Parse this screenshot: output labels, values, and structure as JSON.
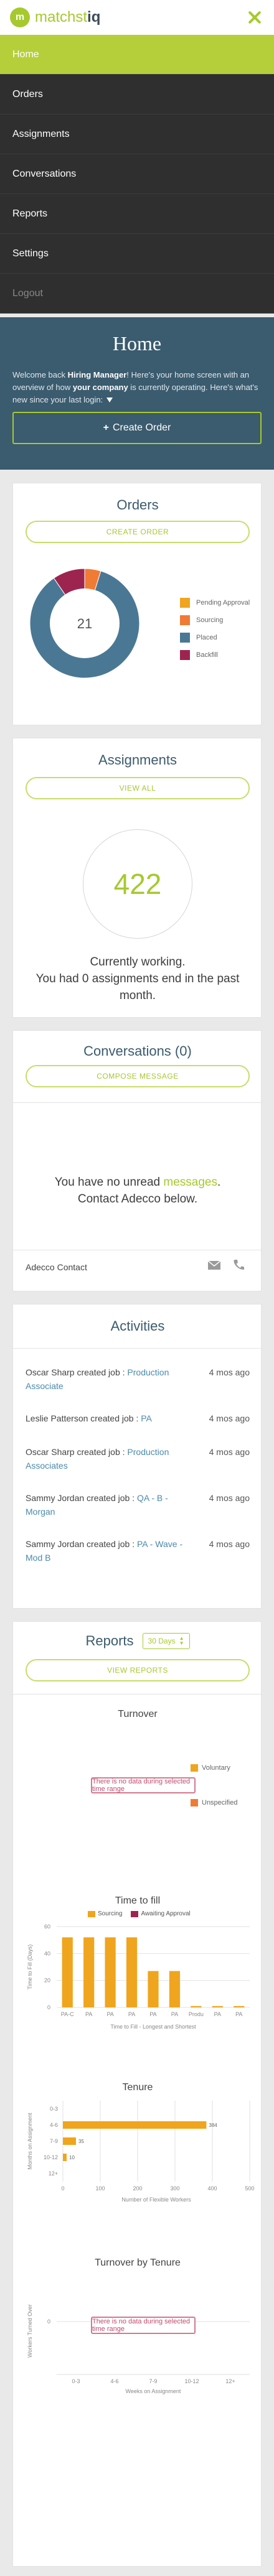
{
  "header": {
    "logo_mark": "m",
    "logo_text_a": "matchst",
    "logo_text_b": "iq"
  },
  "nav": {
    "items": [
      {
        "label": "Home"
      },
      {
        "label": "Orders"
      },
      {
        "label": "Assignments"
      },
      {
        "label": "Conversations"
      },
      {
        "label": "Reports"
      },
      {
        "label": "Settings"
      },
      {
        "label": "Logout"
      }
    ]
  },
  "home": {
    "title": "Home",
    "welcome_a": "Welcome back ",
    "user_name": "Hiring Manager",
    "welcome_b": "! Here's your home screen with an overview of how ",
    "company": "your company",
    "welcome_c": " is currently operating. Here's what's new since your last login:",
    "create_order_label": "Create Order"
  },
  "orders": {
    "title": "Orders",
    "create_label": "CREATE ORDER",
    "total": "21",
    "legend": [
      {
        "label": "Pending Approval",
        "color": "#f0a51e"
      },
      {
        "label": "Sourcing",
        "color": "#f07b34"
      },
      {
        "label": "Placed",
        "color": "#4a7894"
      },
      {
        "label": "Backfill",
        "color": "#9e2450"
      }
    ]
  },
  "chart_data": [
    {
      "type": "pie",
      "title": "Orders",
      "total": 21,
      "categories": [
        "Pending Approval",
        "Sourcing",
        "Placed",
        "Backfill"
      ],
      "values": [
        0,
        1,
        18,
        2
      ],
      "colors": [
        "#f0a51e",
        "#f07b34",
        "#4a7894",
        "#9e2450"
      ]
    },
    {
      "type": "pie",
      "title": "Turnover",
      "categories": [
        "Voluntary",
        "Unspecified"
      ],
      "values": [],
      "colors": [
        "#f0a51e",
        "#f07b34"
      ],
      "notice": "There is no data during selected time range"
    },
    {
      "type": "bar",
      "title": "Time to fill",
      "series": [
        {
          "name": "Sourcing",
          "values": [
            52,
            52,
            52,
            52,
            27,
            27,
            1,
            1,
            1
          ]
        },
        {
          "name": "Awaiting Approval",
          "values": [
            0,
            0,
            0,
            0,
            0,
            0,
            0,
            0,
            0
          ]
        }
      ],
      "categories": [
        "PA-C",
        "PA",
        "PA",
        "PA",
        "PA",
        "PA",
        "Produ",
        "PA",
        "PA"
      ],
      "xlabel": "Time to Fill - Longest and Shortest",
      "ylabel": "Time to Fill (Days)",
      "ylim": [
        0,
        60
      ],
      "yticks": [
        0,
        20,
        40,
        60
      ]
    },
    {
      "type": "bar",
      "orientation": "horizontal",
      "title": "Tenure",
      "categories": [
        "0-3",
        "4-6",
        "7-9",
        "10-12",
        "12+"
      ],
      "values": [
        0,
        384,
        35,
        10,
        0
      ],
      "xlabel": "Number of Flexible Workers",
      "ylabel": "Months on Assignment",
      "xlim": [
        0,
        500
      ],
      "xticks": [
        0,
        100,
        200,
        300,
        400,
        500
      ]
    },
    {
      "type": "bar",
      "title": "Turnover by Tenure",
      "categories": [
        "0-3",
        "4-6",
        "7-9",
        "10-12",
        "12+"
      ],
      "values": [],
      "xlabel": "Weeks on Assignment",
      "ylabel": "Workers Turned Over",
      "yticks": [
        0
      ],
      "notice": "There is no data during selected time range"
    }
  ],
  "assignments": {
    "title": "Assignments",
    "view_label": "VIEW ALL",
    "count": "422",
    "line1": "Currently working.",
    "line2": "You had 0 assignments end in the past month."
  },
  "conversations": {
    "title": "Conversations (0)",
    "compose_label": "COMPOSE MESSAGE",
    "msg_a": "You have no unread ",
    "msg_link": "messages",
    "msg_b": ".",
    "msg_c": "Contact Adecco below.",
    "contact": "Adecco Contact"
  },
  "activities": {
    "title": "Activities",
    "items": [
      {
        "prefix": "Oscar Sharp created job : ",
        "job": "Production Associate",
        "time": "4 mos ago"
      },
      {
        "prefix": "Leslie Patterson created job : ",
        "job": "PA",
        "time": "4 mos ago"
      },
      {
        "prefix": "Oscar Sharp created job : ",
        "job": "Production Associates",
        "time": "4 mos ago"
      },
      {
        "prefix": "Sammy Jordan created job : ",
        "job": "QA - B - Morgan",
        "time": "4 mos ago"
      },
      {
        "prefix": "Sammy Jordan created job : ",
        "job": "PA - Wave - Mod B",
        "time": "4 mos ago"
      }
    ]
  },
  "reports": {
    "title": "Reports",
    "range": "30 Days",
    "view_label": "VIEW REPORTS",
    "turnover_title": "Turnover",
    "ttf_title": "Time to fill",
    "ttf_xlabel": "Time to Fill - Longest and Shortest",
    "ttf_ylabel": "Time to Fill (Days)",
    "tenure_title": "Tenure",
    "tenure_xlabel": "Number of Flexible Workers",
    "tenure_ylabel": "Months on Assignment",
    "tbt_title": "Turnover by Tenure",
    "tbt_xlabel": "Weeks on Assignment",
    "tbt_ylabel": "Workers Turned Over",
    "no_data": "There is no data during selected time range",
    "legend_voluntary": "Voluntary",
    "legend_unspecified": "Unspecified",
    "legend_sourcing": "Sourcing",
    "legend_awaiting": "Awaiting Approval",
    "accent": "#f0a51e",
    "accent2": "#9e2450"
  }
}
